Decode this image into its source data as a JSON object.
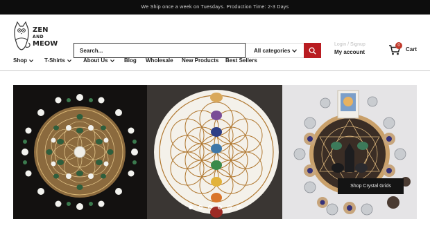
{
  "announcement": "We Ship once a week on Tuesdays. Production Time: 2-3 Days",
  "logo": {
    "line1": "ZEN",
    "line2": "AND",
    "line3": "MEOW"
  },
  "search": {
    "placeholder": "Search...",
    "category": "All categories"
  },
  "account": {
    "login_text": "Login / Signup",
    "label": "My account"
  },
  "cart": {
    "count": "0",
    "label": "Cart"
  },
  "nav": [
    {
      "label": "Shop"
    },
    {
      "label": "T-Shirts"
    },
    {
      "label": "About Us"
    },
    {
      "label": "Blog"
    },
    {
      "label": "Wholesale"
    },
    {
      "label": "New Products"
    },
    {
      "label": "Best Sellers"
    }
  ],
  "hero": {
    "cta_label": "Shop Crystal Grids",
    "slide_count": 6,
    "active_slide": 1
  },
  "colors": {
    "accent": "#b91c21",
    "announcement_bg": "#0d0d0d",
    "badge": "#c0392b"
  }
}
